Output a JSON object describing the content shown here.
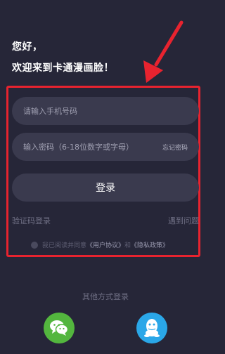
{
  "header": {
    "greeting_line1": "您好，",
    "greeting_line2": "欢迎来到卡通漫画脸！"
  },
  "form": {
    "phone_placeholder": "请输入手机号码",
    "password_placeholder": "输入密码（6-18位数字或字母）",
    "forgot_password": "忘记密码",
    "login_button": "登录",
    "sms_login": "验证码登录",
    "help": "遇到问题",
    "agreement": {
      "prefix": "我已阅读并同意",
      "user_agreement": "《用户协议》",
      "and": "和",
      "privacy_policy": "《隐私政策》",
      "checked": false
    }
  },
  "other_login": {
    "label": "其他方式登录",
    "options": [
      {
        "icon": "wechat-icon",
        "color": "#53b63e"
      },
      {
        "icon": "qq-icon",
        "color": "#2aa7e8"
      }
    ]
  },
  "annotation": {
    "color": "#e8232f"
  }
}
